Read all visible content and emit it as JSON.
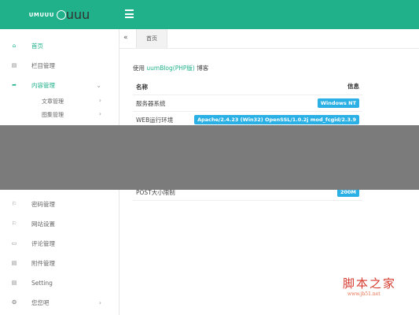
{
  "app": {
    "logo_text": "UMUUU",
    "logo_sub": "uuu"
  },
  "sidebar": {
    "items": [
      {
        "label": "首页",
        "icon": "home-icon",
        "active": true
      },
      {
        "label": "栏目管理",
        "icon": "list-icon"
      },
      {
        "label": "内容管理",
        "icon": "share-icon",
        "active": true,
        "expanded": true
      },
      {
        "label": "密码管理",
        "icon": "flag-icon"
      },
      {
        "label": "网站设置",
        "icon": "flag-icon"
      },
      {
        "label": "评论管理",
        "icon": "comment-icon"
      },
      {
        "label": "附件管理",
        "icon": "file-icon"
      },
      {
        "label": "Setting",
        "icon": "file-icon"
      },
      {
        "label": "您您吧",
        "icon": "settings-icon"
      }
    ],
    "sub_items": [
      {
        "label": "文章管理"
      },
      {
        "label": "图集管理"
      }
    ]
  },
  "tabs": {
    "back": "«",
    "home": "首页"
  },
  "main": {
    "intro_prefix": "使用",
    "intro_app": "uumBlog(PHP版)",
    "intro_suffix": "博客",
    "table": {
      "header": {
        "name": "名称",
        "info": "信息"
      },
      "rows": [
        {
          "name": "服务器系统",
          "info": "Windows NT"
        },
        {
          "name": "WEB运行环境",
          "info": "Apache/2.4.23 (Win32) OpenSSL/1.0.2j mod_fcgid/2.3.9"
        },
        {
          "name": "POST大小限制",
          "info": "200M"
        }
      ]
    }
  },
  "watermark": {
    "title": "脚本之家",
    "url": "www.jb51.net"
  },
  "colors": {
    "accent": "#20b18a",
    "badge": "#2bb0e6",
    "overlay": "#7b7b7b"
  }
}
